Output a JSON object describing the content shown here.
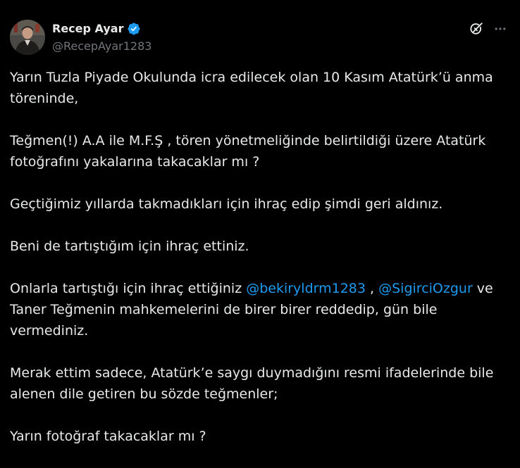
{
  "author": {
    "display_name": "Recep Ayar",
    "handle": "@RecepAyar1283",
    "verified": true,
    "verified_color": "#1d9bf0"
  },
  "actions": {
    "grok_icon": "grok-icon",
    "more_icon": "more-horizontal-icon"
  },
  "tweet": {
    "para1": "Yarın Tuzla Piyade Okulunda icra edilecek olan 10 Kasım Atatürk’ü anma töreninde,",
    "para2": "Teğmen(!) A.A ile M.F.Ş , tören yönetmeliğinde belirtildiği üzere Atatürk fotoğrafını yakalarına takacaklar mı ?",
    "para3": "Geçtiğimiz yıllarda takmadıkları için ihraç edip şimdi geri aldınız.",
    "para4": "Beni de tartıştığım için ihraç ettiniz.",
    "para5_before": "Onlarla tartıştığı için ihraç ettiğiniz ",
    "mention1": "@bekiryldrm1283",
    "para5_sep": " , ",
    "mention2": "@SigirciOzgur",
    "para5_after": " ve Taner Teğmenin mahkemelerini de birer birer reddedip, gün bile vermediniz.",
    "para6": "Merak ettim sadece, Atatürk’e saygı duymadığını resmi ifadelerinde bile alenen dile getiren bu sözde teğmenler;",
    "para7": "Yarın fotoğraf takacaklar mı ?"
  },
  "colors": {
    "background": "#000000",
    "text": "#e7e9ea",
    "secondary": "#71767b",
    "link": "#1d9bf0"
  }
}
